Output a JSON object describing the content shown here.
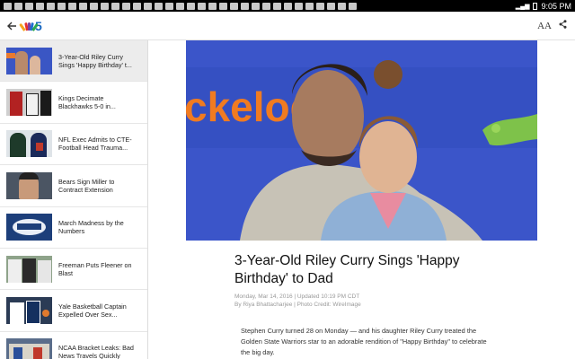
{
  "status_bar": {
    "time": "9:05 PM",
    "notification_icons": [
      "yahoo-icon",
      "sports-icon",
      "news-icon",
      "nyt-icon",
      "app-icon",
      "app-icon",
      "app-icon",
      "app-icon",
      "app-icon",
      "app-icon",
      "app-icon",
      "app-icon",
      "app-icon",
      "app-icon",
      "app-icon",
      "app-icon",
      "app-icon",
      "app-icon",
      "app-icon",
      "app-icon",
      "app-icon",
      "app-icon",
      "app-icon",
      "app-icon",
      "app-icon",
      "app-icon",
      "app-icon",
      "download-icon",
      "app-icon",
      "download-icon",
      "app-icon",
      "download-icon",
      "nyt-icon"
    ]
  },
  "app_bar": {
    "logo_number": "5",
    "text_size_label": "AA",
    "colors": {
      "logo_blue": "#1565c0"
    }
  },
  "sidebar": {
    "items": [
      {
        "title": "3-Year-Old Riley Curry Sings 'Happy Birthday' t...",
        "active": true
      },
      {
        "title": "Kings Decimate Blackhawks 5-0 in...",
        "active": false
      },
      {
        "title": "NFL Exec Admits to CTE-Football Head Trauma...",
        "active": false
      },
      {
        "title": "Bears Sign Miller to Contract Extension",
        "active": false
      },
      {
        "title": "March Madness by the Numbers",
        "active": false
      },
      {
        "title": "Freeman Puts Fleener on Blast",
        "active": false
      },
      {
        "title": "Yale Basketball Captain Expelled Over Sex...",
        "active": false
      },
      {
        "title": "NCAA Bracket Leaks: Bad News Travels Quickly",
        "active": false
      }
    ]
  },
  "article": {
    "hero_sign_text": "ckelode",
    "headline": "3-Year-Old Riley Curry Sings 'Happy Birthday' to Dad",
    "date_line": "Monday, Mar 14, 2016  |  Updated 10:19 PM CDT",
    "byline": "By Riya Bhattacharjee  |  Photo Credit: WireImage",
    "body": "Stephen Curry turned 28 on Monday — and his daughter Riley Curry treated the Golden State Warriors star to an adorable rendition of \"Happy Birthday\" to celebrate the big day."
  }
}
